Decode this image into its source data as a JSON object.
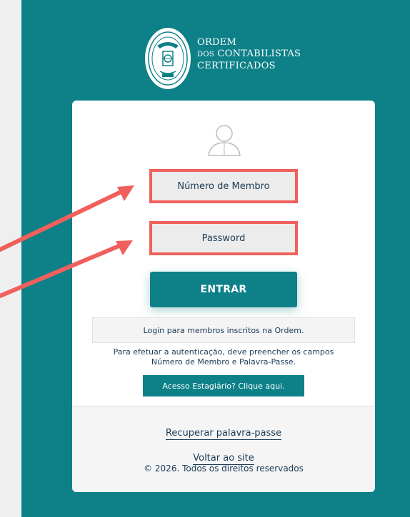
{
  "org": {
    "line1": "Ordem",
    "line2_prefix": "dos",
    "line2_main": "Contabilistas",
    "line3": "Certificados"
  },
  "login": {
    "username_placeholder": "Número de Membro",
    "password_placeholder": "Password",
    "submit_label": "ENTRAR",
    "members_note": "Login para membros inscritos na Ordem.",
    "auth_line1": "Para efetuar a autenticação, deve preencher os campos",
    "auth_line2": "Número de Membro e Palavra-Passe.",
    "intern_button": "Acesso Estagiário? Clique aqui."
  },
  "footer": {
    "recover_link": "Recuperar palavra-passe",
    "back_link": "Voltar ao site",
    "copyright": "© 2026. Todos os direitos reservados"
  },
  "colors": {
    "brand_teal": "#0d8088",
    "annotation_red": "#f0605c"
  },
  "icons": [
    "logo-seal-icon",
    "user-icon",
    "annotation-arrow-icon"
  ]
}
